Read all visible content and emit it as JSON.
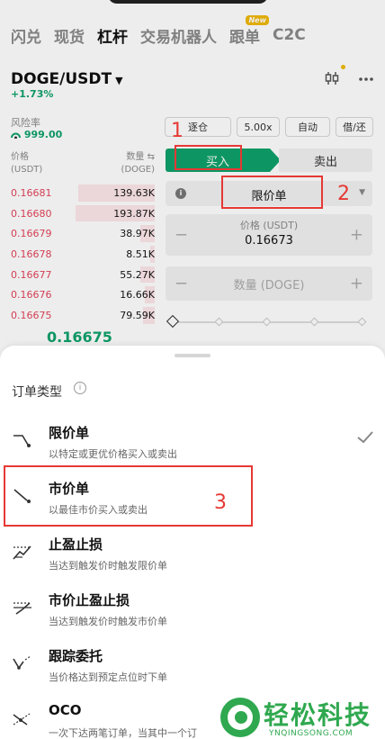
{
  "nav": {
    "tabs": [
      {
        "label": "闪兑"
      },
      {
        "label": "现货"
      },
      {
        "label": "杠杆"
      },
      {
        "label": "交易机器人"
      },
      {
        "label": "跟单"
      },
      {
        "label": "C2C"
      }
    ],
    "new_badge": "New",
    "active_tab": "杠杆"
  },
  "pair": {
    "symbol": "DOGE/USDT",
    "change": "+1.73%"
  },
  "risk": {
    "label": "风险率",
    "value": "999.00"
  },
  "orderbook": {
    "price_header": "价格",
    "price_unit": "(USDT)",
    "qty_header": "数量",
    "qty_unit": "(DOGE)",
    "asks": [
      {
        "price": "0.16681",
        "qty": "139.63K",
        "depth": 0.53
      },
      {
        "price": "0.16680",
        "qty": "193.87K",
        "depth": 0.55
      },
      {
        "price": "0.16679",
        "qty": "38.97K",
        "depth": 0.1
      },
      {
        "price": "0.16678",
        "qty": "8.51K",
        "depth": 0.03
      },
      {
        "price": "0.16677",
        "qty": "55.27K",
        "depth": 0.1
      },
      {
        "price": "0.16676",
        "qty": "16.66K",
        "depth": 0.07
      },
      {
        "price": "0.16675",
        "qty": "79.59K",
        "depth": 0.08
      }
    ],
    "last_price": "0.16675"
  },
  "trade_panel": {
    "modes": [
      "逐仓",
      "5.00x",
      "自动",
      "借/还"
    ],
    "buy_label": "买入",
    "sell_label": "卖出",
    "order_type": "限价单",
    "price_label": "价格 (USDT)",
    "price_value": "0.16673",
    "qty_label": "数量 (DOGE)",
    "minus": "−",
    "plus": "+"
  },
  "annotations": [
    "1",
    "2",
    "3"
  ],
  "sheet": {
    "title": "订单类型",
    "options": [
      {
        "name": "限价单",
        "desc": "以特定或更优价格买入或卖出",
        "selected": true
      },
      {
        "name": "市价单",
        "desc": "以最佳市价买入或卖出",
        "selected": false
      },
      {
        "name": "止盈止损",
        "desc": "当达到触发价时触发限价单",
        "selected": false
      },
      {
        "name": "市价止盈止损",
        "desc": "当达到触发价时触发市价单",
        "selected": false
      },
      {
        "name": "跟踪委托",
        "desc": "当价格达到预定点位时下单",
        "selected": false
      },
      {
        "name": "OCO",
        "desc": "一次下达两笔订单，当其中一个订",
        "selected": false
      }
    ]
  },
  "watermark": {
    "text": "轻松科技",
    "sub": "YNQINGSONG.COM"
  },
  "colors": {
    "buy_green": "#0fa26b",
    "sell_red": "#e4445a",
    "annotation_red": "#e53935",
    "watermark_green": "#2fa84f"
  }
}
